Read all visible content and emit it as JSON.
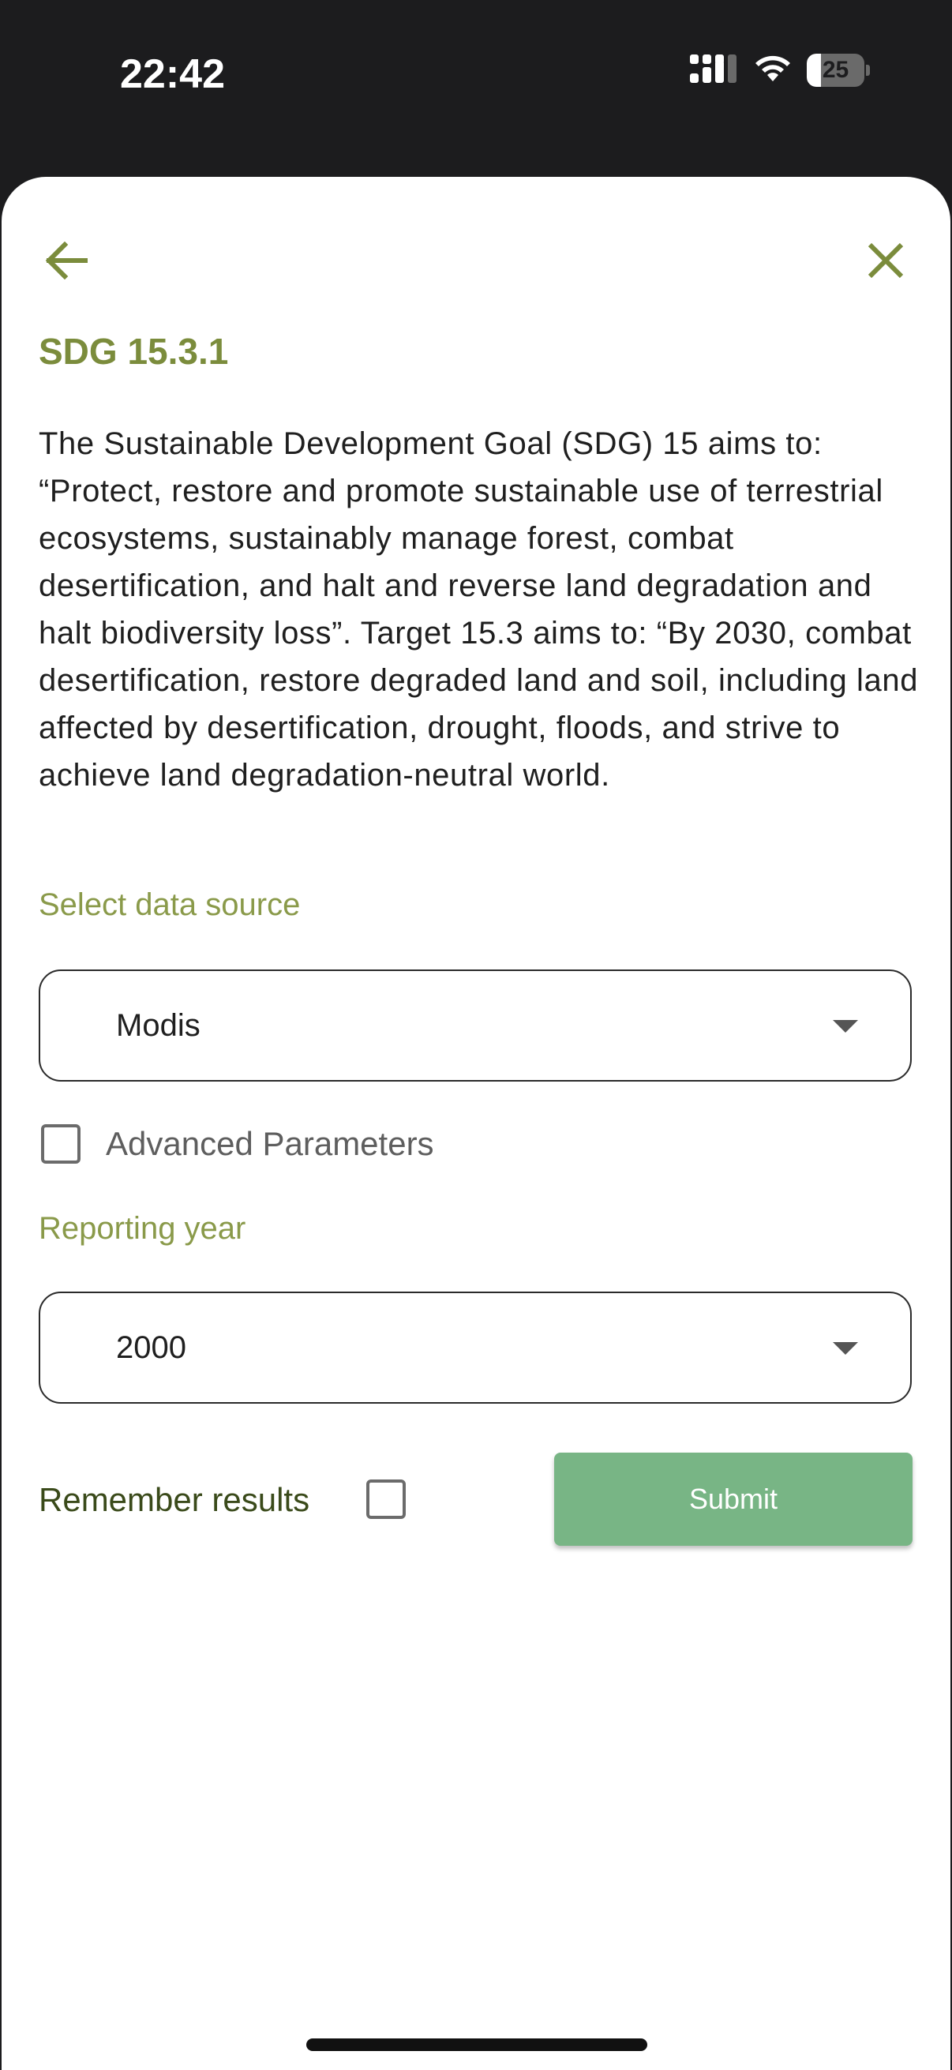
{
  "status_bar": {
    "time": "22:42",
    "battery_level": "25",
    "battery_fraction": 0.25,
    "icons": [
      "cellular-signal-icon",
      "wifi-icon",
      "battery-icon"
    ]
  },
  "header": {
    "back_icon": "arrow-left-icon",
    "close_icon": "close-icon",
    "title": "SDG 15.3.1"
  },
  "description": "The Sustainable Development Goal (SDG) 15 aims to: “Protect, restore and promote sustainable use of terrestrial ecosystems, sustainably manage forest, combat desertification, and halt and reverse land degradation and halt biodiversity loss”. Target 15.3 aims to: “By 2030, combat desertification, restore degraded land and soil, including land affected by desertification, drought, floods, and strive to achieve land degradation-neutral world.",
  "data_source": {
    "label": "Select data source",
    "selected": "Modis"
  },
  "advanced_parameters": {
    "label": "Advanced Parameters",
    "checked": false
  },
  "reporting_year": {
    "label": "Reporting year",
    "selected": "2000"
  },
  "remember_results": {
    "label": "Remember results",
    "checked": false
  },
  "submit": {
    "label": "Submit"
  },
  "colors": {
    "accent": "#7b8c3c",
    "label_green": "#8a9a4a",
    "submit_bg": "#78b585",
    "status_bar_bg": "#1c1c1e"
  }
}
